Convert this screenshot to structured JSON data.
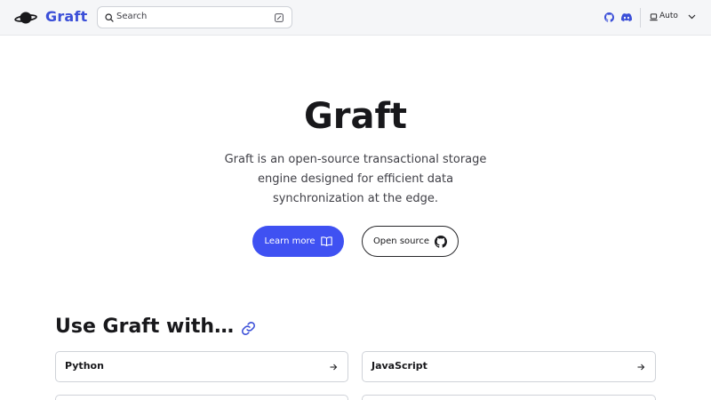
{
  "header": {
    "brand": "Graft",
    "search": {
      "placeholder": "Search"
    },
    "theme": {
      "label": "Auto"
    }
  },
  "hero": {
    "title": "Graft",
    "description": "Graft is an open-source transactional storage engine designed for efficient data synchronization at the edge.",
    "primary_button": "Learn more",
    "secondary_button": "Open source"
  },
  "section": {
    "title": "Use Graft with…",
    "cards": [
      {
        "label": "Python"
      },
      {
        "label": "JavaScript"
      }
    ]
  },
  "colors": {
    "accent": "#3f51f2",
    "brand": "#3b4fd8",
    "header_bg": "#f5f6f8"
  },
  "icons": [
    "planet-logo-icon",
    "search-icon",
    "keyboard-shortcut-icon",
    "github-icon",
    "discord-icon",
    "laptop-icon",
    "chevron-down-icon",
    "book-icon",
    "github-icon",
    "link-icon",
    "arrow-right-icon"
  ]
}
